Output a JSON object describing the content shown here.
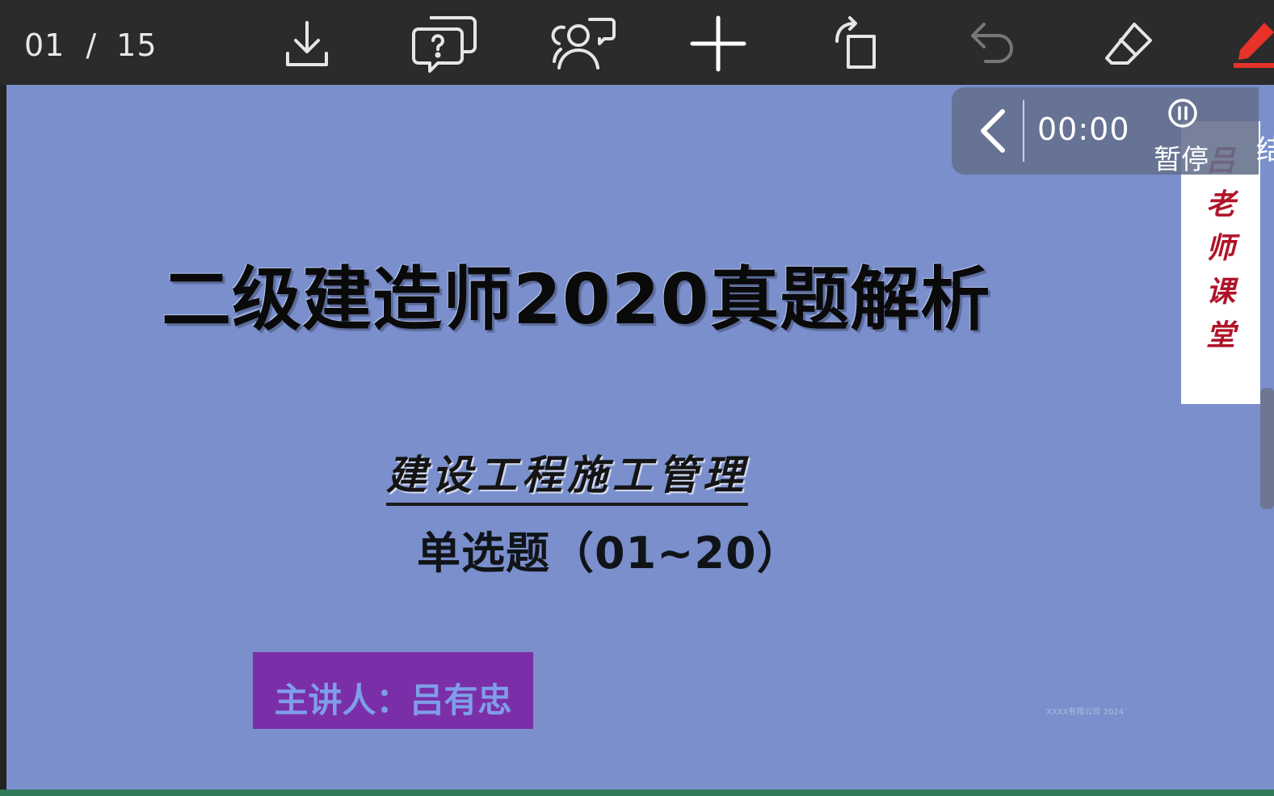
{
  "toolbar": {
    "page_current": "01",
    "page_separator": "/",
    "page_total": "15",
    "tools": [
      {
        "name": "download-icon"
      },
      {
        "name": "question-chat-icon"
      },
      {
        "name": "people-chat-icon"
      },
      {
        "name": "plus-icon"
      },
      {
        "name": "rotate-icon"
      },
      {
        "name": "undo-icon"
      },
      {
        "name": "eraser-icon"
      },
      {
        "name": "pen-icon"
      }
    ],
    "pen_color": "#e8322a"
  },
  "timer": {
    "time": "00:00",
    "pause_label": "暂停",
    "extra_label": "结"
  },
  "brand": {
    "chars": [
      "吕",
      "老",
      "师",
      "课",
      "堂"
    ],
    "color": "#b0142a"
  },
  "slide": {
    "background": "#7a8fcc",
    "title": "二级建造师2020真题解析",
    "subtitle": "建设工程施工管理",
    "topic": "单选题（01~20）",
    "presenter": "主讲人：吕有忠",
    "footer_note": "XXXX有限公司 2024"
  }
}
